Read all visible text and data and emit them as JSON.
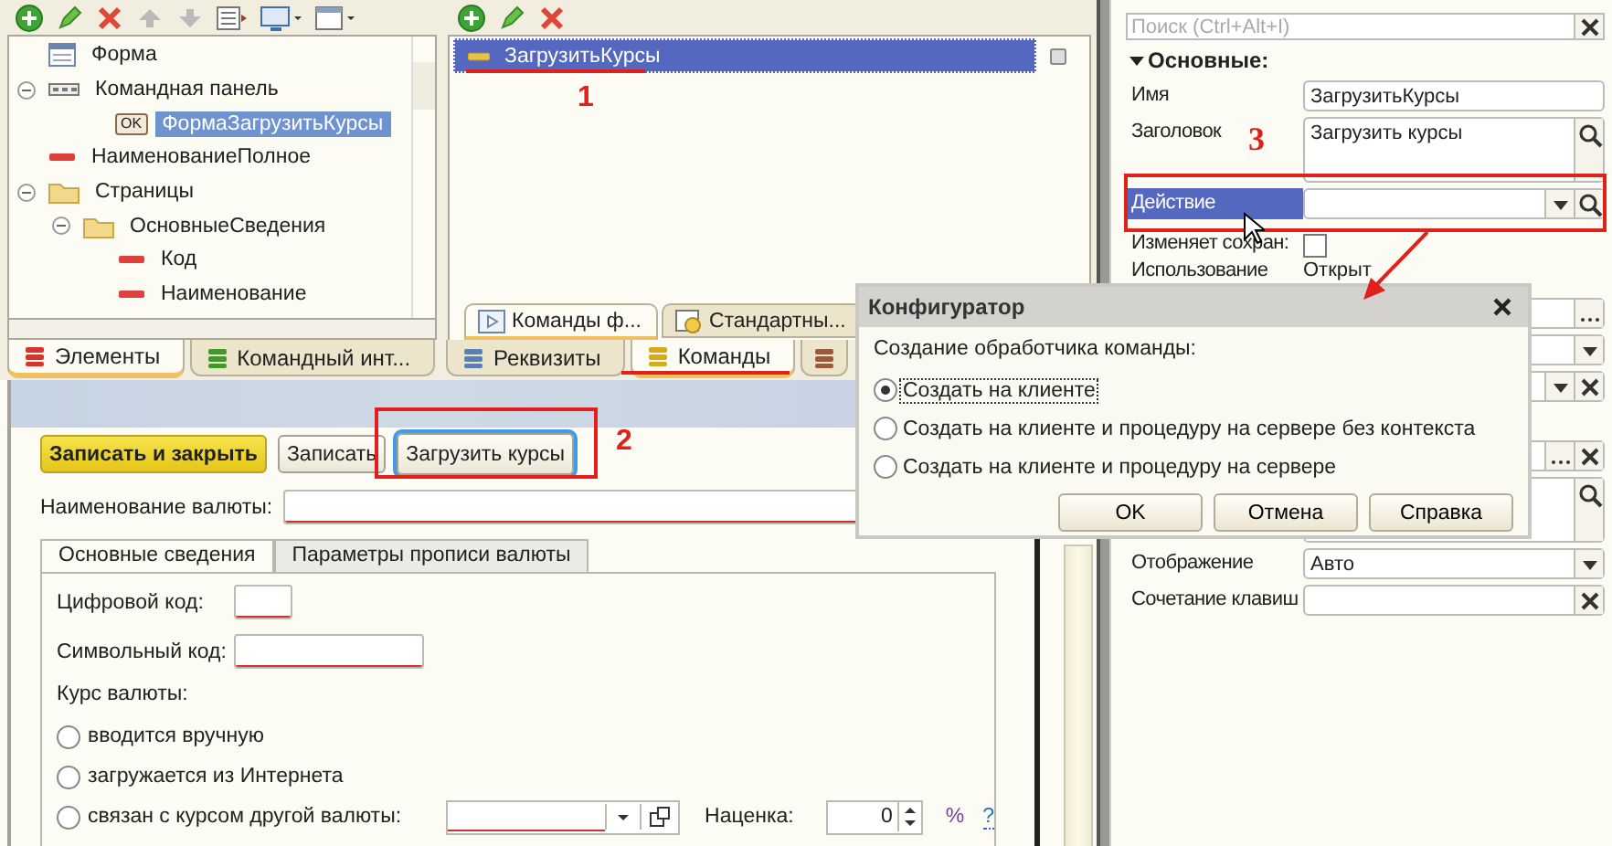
{
  "element_tree": [
    {
      "label": "Форма",
      "kind": "form",
      "selected": false
    },
    {
      "label": "Командная панель",
      "kind": "command-bar",
      "selected": false,
      "expanded": true,
      "children": [
        {
          "label": "ФормаЗагрузитьКурсы",
          "kind": "button",
          "badge": "OK",
          "selected": true
        }
      ]
    },
    {
      "label": "НаименованиеПолное",
      "kind": "field",
      "selected": false
    },
    {
      "label": "Страницы",
      "kind": "group",
      "selected": false,
      "expanded": true,
      "children": [
        {
          "label": "ОсновныеСведения",
          "kind": "group",
          "selected": false,
          "expanded": true,
          "children": [
            {
              "label": "Код",
              "kind": "field",
              "selected": false
            },
            {
              "label": "Наименование",
              "kind": "field",
              "selected": false
            }
          ]
        }
      ]
    }
  ],
  "left_tabs": [
    {
      "label": "Элементы",
      "color": "#d9342b",
      "selected": true
    },
    {
      "label": "Командный инт...",
      "color": "#3f9a2a",
      "selected": false
    }
  ],
  "commands": [
    {
      "label": "ЗагрузитьКурсы",
      "selected": true
    }
  ],
  "command_subtabs": [
    {
      "label": "Команды ф...",
      "kind": "form-commands",
      "selected": true
    },
    {
      "label": "Стандартны...",
      "kind": "standard",
      "selected": false
    }
  ],
  "middle_tabs": [
    {
      "label": "Реквизиты",
      "color": "#5b7fb2",
      "selected": false
    },
    {
      "label": "Команды",
      "color": "#d8a91f",
      "selected": true
    },
    {
      "color": "#9a5b3c",
      "selected": false
    }
  ],
  "form_preview": {
    "buttons": [
      {
        "label": "Записать и закрыть",
        "kind": "default"
      },
      {
        "label": "Записать",
        "kind": "normal"
      },
      {
        "label": "Загрузить курсы",
        "kind": "focused"
      }
    ],
    "name_label": "Наименование валюты:",
    "tabs": [
      {
        "label": "Основные сведения",
        "selected": true
      },
      {
        "label": "Параметры прописи валюты",
        "selected": false
      }
    ],
    "code_fields": [
      {
        "label": "Цифровой код:",
        "kind": "short"
      },
      {
        "label": "Символьный код:",
        "kind": "medium"
      }
    ],
    "rate_label": "Курс валюты:",
    "rate_options": [
      {
        "label": "вводится вручную",
        "kind": "plain",
        "selected": false
      },
      {
        "label": "загружается из Интернета",
        "kind": "plain",
        "selected": false
      },
      {
        "label": "связан с курсом другой валюты:",
        "kind": "linked",
        "selected": false
      }
    ],
    "markup_label": "Наценка:",
    "markup_value": "0",
    "percent": "%",
    "help": "?"
  },
  "properties": {
    "search_placeholder": "Поиск (Ctrl+Alt+I)",
    "section": {
      "label": "Основные:",
      "expanded": true
    },
    "rows": [
      {
        "label": "Имя",
        "kind": "field",
        "value": "ЗагрузитьКурсы",
        "selected": false
      },
      {
        "label": "Заголовок",
        "kind": "multiline",
        "value": "Загрузить курсы",
        "buttons": [
          {
            "kind": "search"
          }
        ],
        "selected": false
      },
      {
        "label": "Действие",
        "kind": "field",
        "buttons": [
          {
            "kind": "drop"
          },
          {
            "kind": "search"
          }
        ],
        "selected": true
      },
      {
        "label": "Изменяет сохран:",
        "kind": "checkbox",
        "checked": false,
        "selected": false
      },
      {
        "label": "Использование",
        "kind": "plain",
        "value": "Открыт",
        "selected": false
      },
      {
        "kind": "field",
        "buttons": [
          {
            "kind": "ellipsis"
          }
        ]
      },
      {
        "kind": "field",
        "buttons": [
          {
            "kind": "drop"
          }
        ]
      },
      {
        "kind": "field",
        "buttons": [
          {
            "kind": "drop"
          },
          {
            "kind": "clear"
          }
        ]
      },
      {
        "kind": "gap"
      },
      {
        "kind": "field",
        "buttons": [
          {
            "kind": "ellipsis"
          },
          {
            "kind": "clear"
          }
        ]
      },
      {
        "kind": "multiline",
        "buttons": [
          {
            "kind": "search"
          }
        ]
      },
      {
        "label": "Отображение",
        "kind": "field",
        "value": "Авто",
        "buttons": [
          {
            "kind": "drop"
          }
        ],
        "selected": false
      },
      {
        "label": "Сочетание клавиш",
        "kind": "field",
        "buttons": [
          {
            "kind": "clear"
          }
        ],
        "selected": false
      }
    ]
  },
  "dialog": {
    "title": "Конфигуратор",
    "prompt": "Создание обработчика команды:",
    "options": [
      {
        "label": "Создать на клиенте",
        "selected": true
      },
      {
        "label": "Создать на клиенте и процедуру на сервере без контекста",
        "selected": false
      },
      {
        "label": "Создать на клиенте и процедуру на сервере",
        "selected": false
      }
    ],
    "buttons": [
      "OK",
      "Отмена",
      "Справка"
    ]
  },
  "annotations": [
    {
      "text": "1",
      "kind": "sans"
    },
    {
      "text": "2",
      "kind": "sans"
    },
    {
      "text": "3",
      "kind": "serif"
    }
  ]
}
